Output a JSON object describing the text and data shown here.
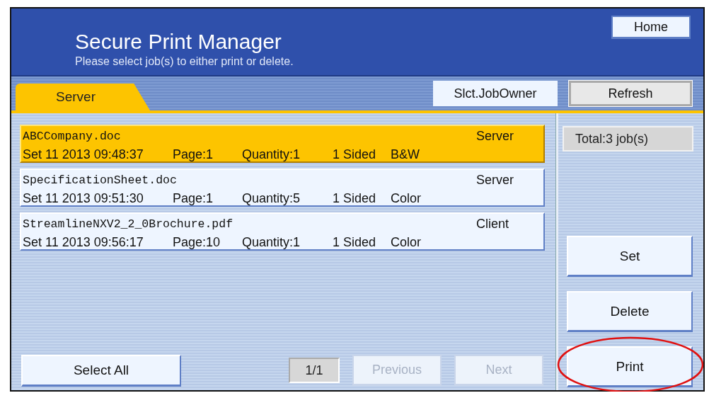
{
  "header": {
    "title": "Secure Print Manager",
    "subtitle": "Please select job(s) to either print or delete.",
    "home_button": "Home"
  },
  "tabs": [
    {
      "label": "Server",
      "selected": true
    }
  ],
  "toolbar_buttons": [
    {
      "label": "Slct.JobOwner",
      "kind": "plain"
    },
    {
      "label": "Refresh",
      "kind": "framed"
    }
  ],
  "jobs": [
    {
      "name": "ABCCompany.doc",
      "source": "Server",
      "date": "Set 11 2013 09:48:37",
      "pages": "Page:1",
      "quantity": "Quantity:1",
      "sides": "1 Sided",
      "color_mode": "B&W",
      "selected": true
    },
    {
      "name": "SpecificationSheet.doc",
      "source": "Server",
      "date": "Set 11 2013 09:51:30",
      "pages": "Page:1",
      "quantity": "Quantity:5",
      "sides": "1 Sided",
      "color_mode": "Color",
      "selected": false
    },
    {
      "name": "StreamlineNXV2_2_0Brochure.pdf",
      "source": "Client",
      "date": "Set 11 2013 09:56:17",
      "pages": "Page:10",
      "quantity": "Quantity:1",
      "sides": "1 Sided",
      "color_mode": "Color",
      "selected": false
    }
  ],
  "total": "Total:3 job(s)",
  "actions": [
    {
      "label": "Set",
      "highlighted": false
    },
    {
      "label": "Delete",
      "highlighted": false
    },
    {
      "label": "Print",
      "highlighted": true
    }
  ],
  "footer": {
    "select_all": "Select All",
    "page_indicator": "1/1",
    "nav": [
      {
        "label": "Previous",
        "disabled": true
      },
      {
        "label": "Next",
        "disabled": true
      }
    ]
  }
}
